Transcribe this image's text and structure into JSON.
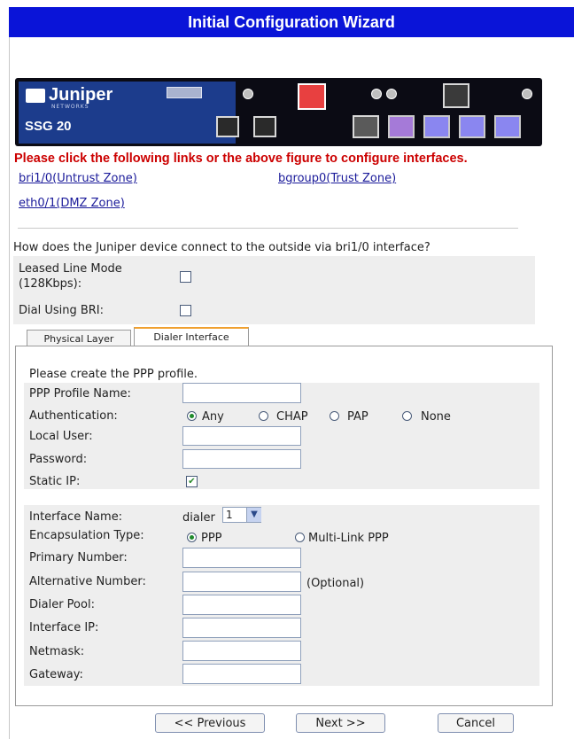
{
  "title": "Initial Configuration Wizard",
  "device": {
    "brand": "Juniper",
    "brand_sub": "NETWORKS",
    "model": "SSG 20"
  },
  "instruction": "Please click the following links or the above figure to configure interfaces.",
  "links": {
    "untrust": "bri1/0(Untrust Zone)",
    "trust": "bgroup0(Trust Zone)",
    "dmz": "eth0/1(DMZ Zone)"
  },
  "question": "How does the Juniper device connect to the outside via bri1/0 interface?",
  "mode": {
    "leased_line_label": "Leased Line Mode\n(128Kbps):",
    "leased_line_checked": false,
    "dial_bri_label": "Dial Using BRI:",
    "dial_bri_checked": false
  },
  "tabs": {
    "physical": "Physical Layer",
    "dialer": "Dialer Interface",
    "active": "dialer"
  },
  "ppp": {
    "intro": "Please create the PPP profile.",
    "profile_name_label": "PPP Profile Name:",
    "profile_name_value": "",
    "auth_label": "Authentication:",
    "auth_options": [
      "Any",
      "CHAP",
      "PAP",
      "None"
    ],
    "auth_selected": "Any",
    "local_user_label": "Local User:",
    "local_user_value": "",
    "password_label": "Password:",
    "password_value": "",
    "static_ip_label": "Static IP:",
    "static_ip_checked": true
  },
  "dialer": {
    "iface_name_label": "Interface Name:",
    "iface_prefix": "dialer",
    "iface_number": "1",
    "encap_label": "Encapsulation Type:",
    "encap_options": [
      "PPP",
      "Multi-Link PPP"
    ],
    "encap_selected": "PPP",
    "primary_label": "Primary Number:",
    "primary_value": "",
    "alt_label": "Alternative Number:",
    "alt_value": "",
    "alt_hint": "(Optional)",
    "pool_label": "Dialer Pool:",
    "pool_value": "",
    "ip_label": "Interface IP:",
    "ip_value": "",
    "netmask_label": "Netmask:",
    "netmask_value": "",
    "gateway_label": "Gateway:",
    "gateway_value": ""
  },
  "buttons": {
    "previous": "<< Previous",
    "next": "Next >>",
    "cancel": "Cancel"
  },
  "colors": {
    "title_bar": "#0a14d8",
    "instruction_text": "#cc0000",
    "link": "#1a1a9a",
    "active_tab_accent": "#f0a030"
  }
}
